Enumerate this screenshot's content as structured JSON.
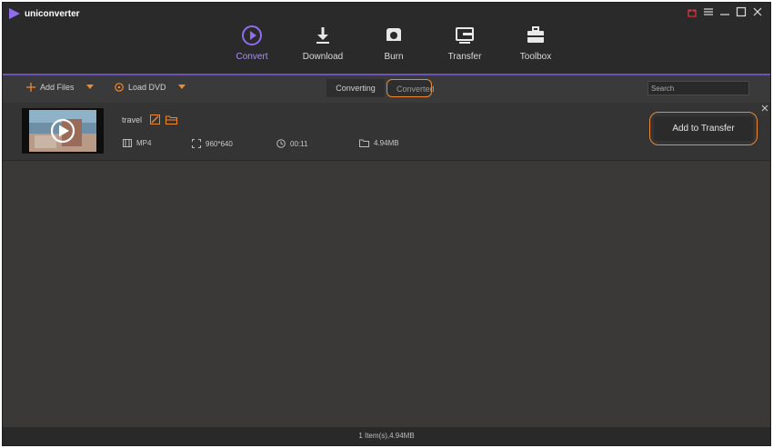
{
  "app": {
    "title": "uniconverter"
  },
  "nav": [
    {
      "label": "Convert",
      "icon": "convert-icon",
      "active": true
    },
    {
      "label": "Download",
      "icon": "download-icon"
    },
    {
      "label": "Burn",
      "icon": "burn-icon"
    },
    {
      "label": "Transfer",
      "icon": "transfer-icon"
    },
    {
      "label": "Toolbox",
      "icon": "toolbox-icon"
    }
  ],
  "toolbar": {
    "add_files": "Add Files",
    "load_dvd": "Load DVD",
    "tabs": {
      "converting": "Converting",
      "converted": "Converted"
    },
    "search_placeholder": "Search"
  },
  "file": {
    "name": "travel",
    "format": "MP4",
    "resolution": "960*640",
    "duration": "00:11",
    "size": "4.94MB"
  },
  "actions": {
    "add_to_transfer": "Add to Transfer"
  },
  "status": {
    "summary": "1 Item(s),4.94MB"
  },
  "colors": {
    "accent": "#f0882c",
    "brand": "#8f6cf0",
    "background": "#3b3838"
  }
}
